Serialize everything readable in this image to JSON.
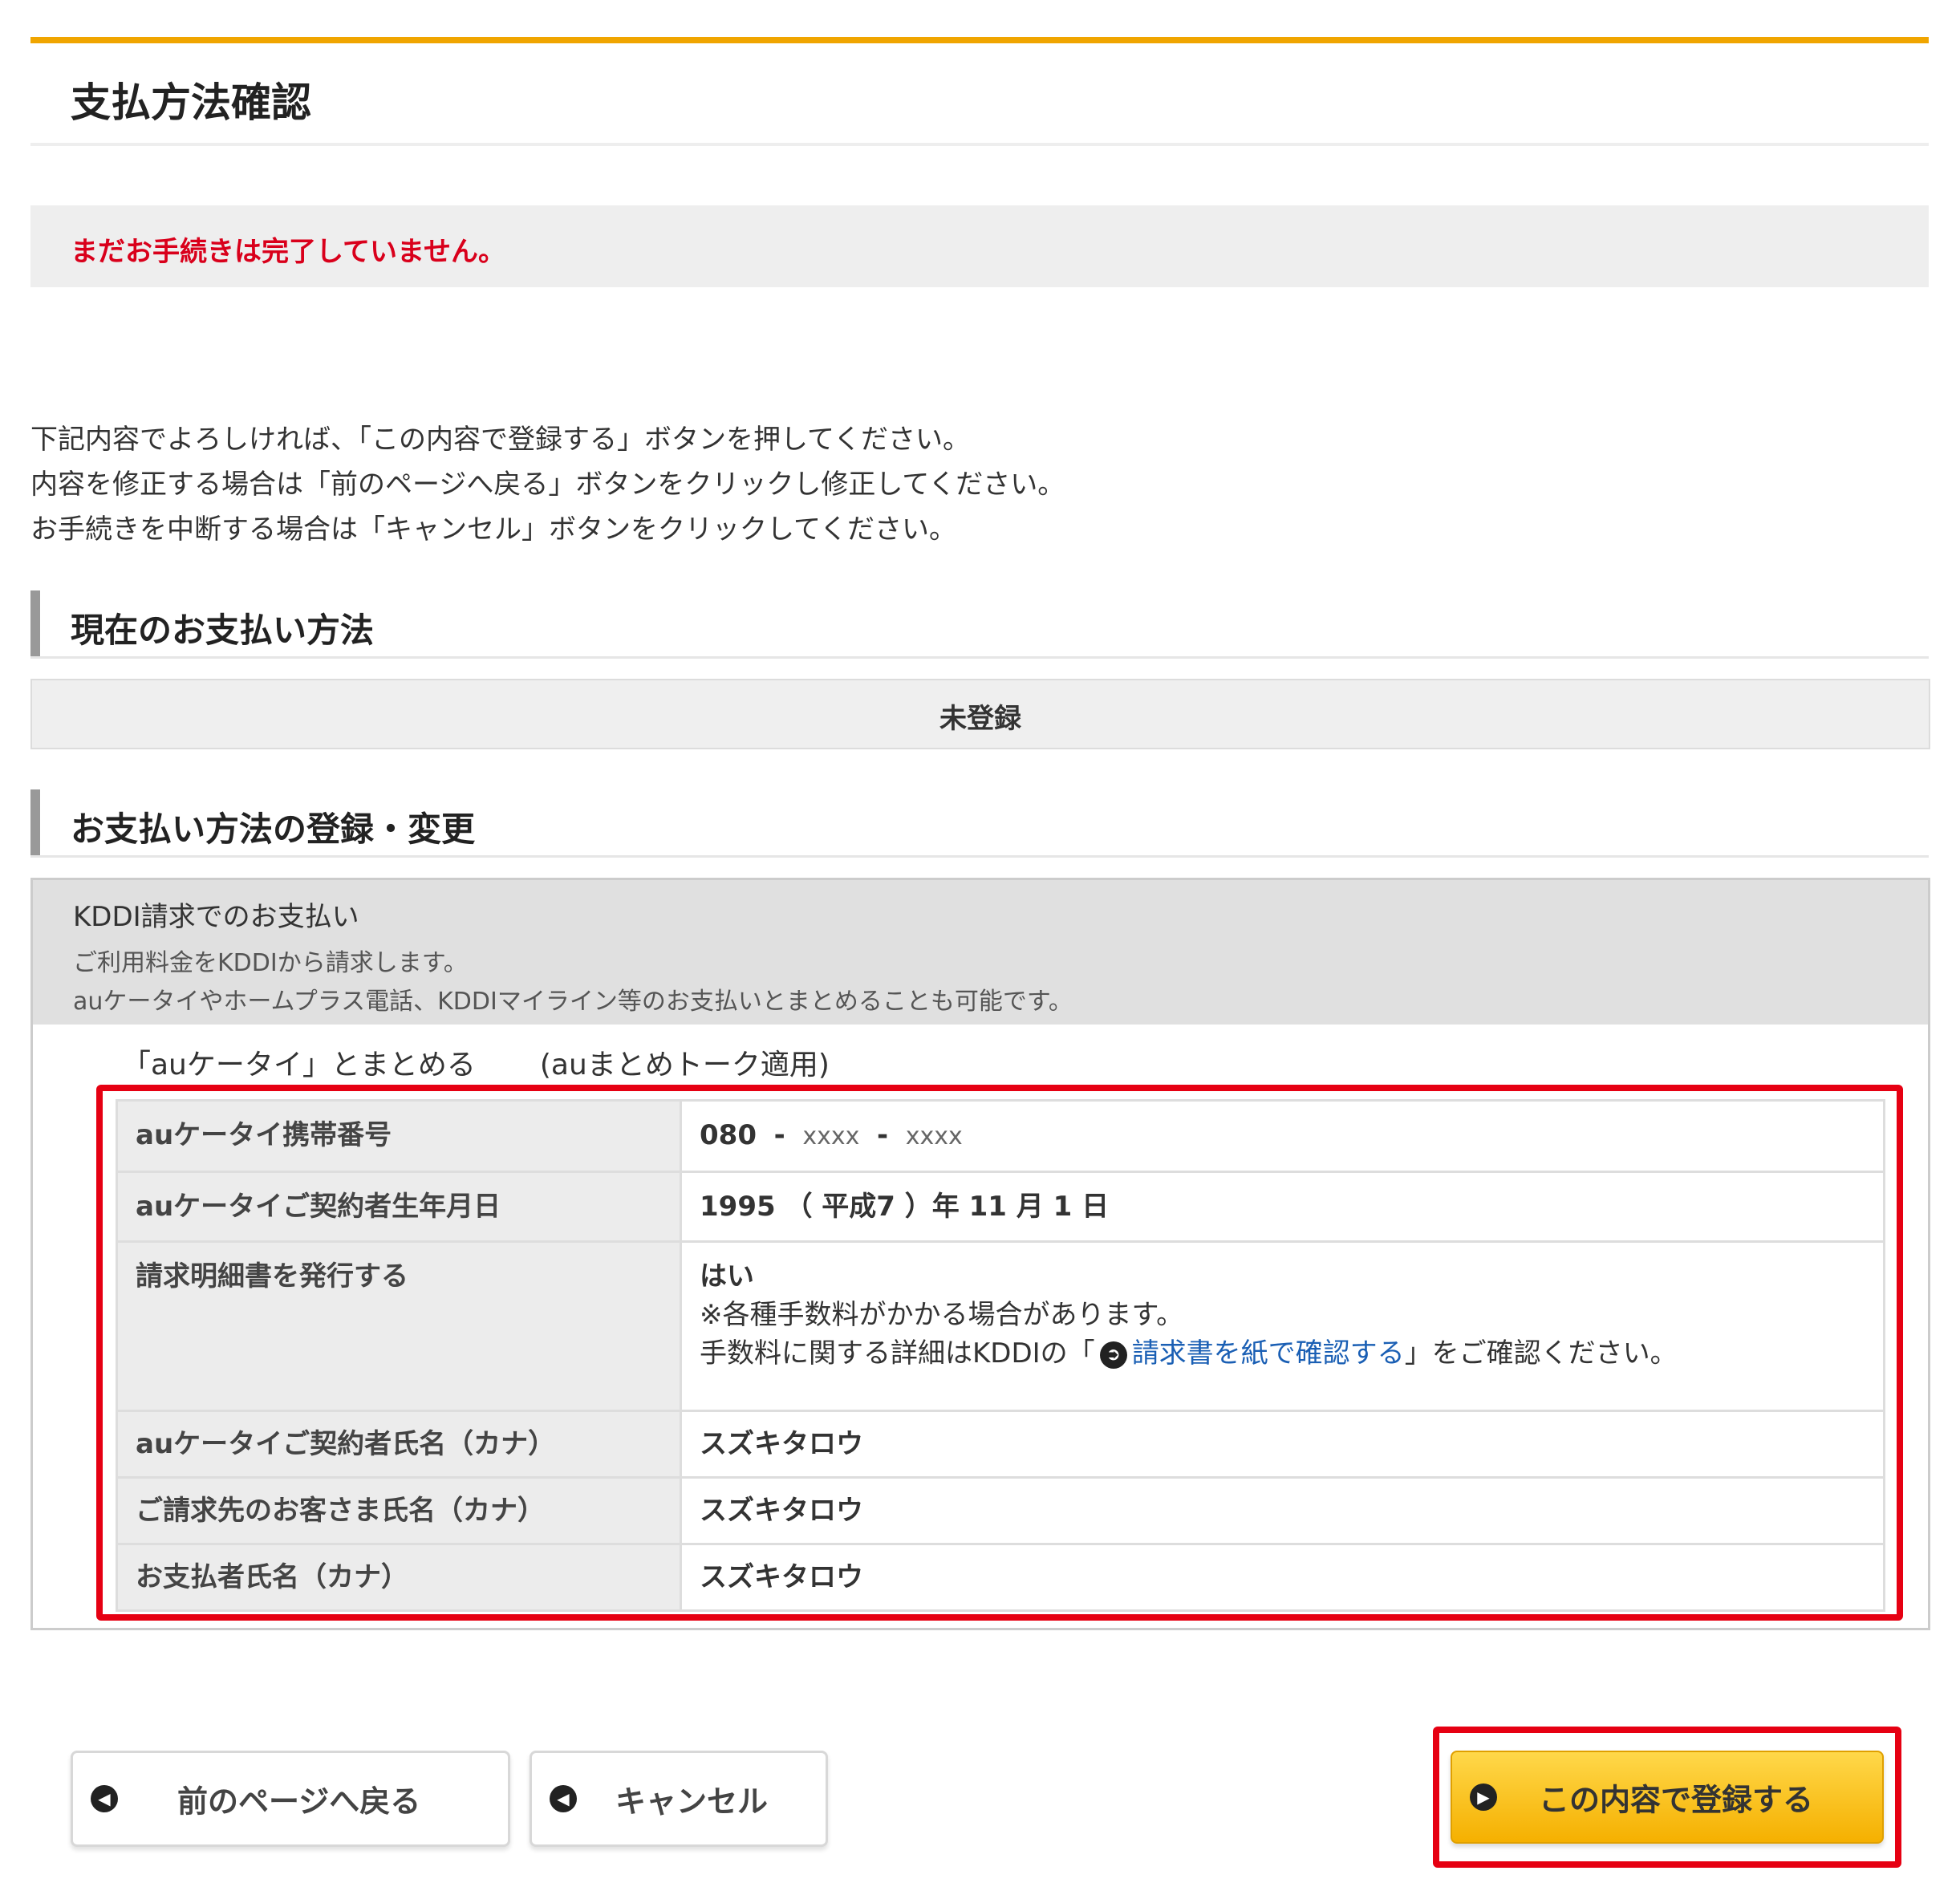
{
  "header": {
    "title": "支払方法確認",
    "notice": "まだお手続きは完了していません。"
  },
  "intro": [
    "下記内容でよろしければ、「この内容で登録する」ボタンを押してください。",
    "内容を修正する場合は「前のページへ戻る」ボタンをクリックし修正してください。",
    "お手続きを中断する場合は「キャンセル」ボタンをクリックしてください。"
  ],
  "current_section": {
    "heading": "現在のお支払い方法",
    "value": "未登録"
  },
  "register_section": {
    "heading": "お支払い方法の登録・変更",
    "kddi_title": "KDDI請求でのお支払い",
    "kddi_desc_1": "ご利用料金をKDDIから請求します。",
    "kddi_desc_2": "auケータイやホームプラス電話、KDDIマイライン等のお支払いとまとめることも可能です。",
    "combine_label": "「auケータイ」とまとめる",
    "combine_note": "(auまとめトーク適用)"
  },
  "table": {
    "phone_label": "auケータイ携帯番号",
    "phone_1": "080",
    "phone_sep": "-",
    "phone_2": "xxxx",
    "phone_3": "xxxx",
    "birth_label": "auケータイご契約者生年月日",
    "birth_value": "1995 （ 平成7 ）年 11 月 1 日",
    "invoice_label": "請求明細書を発行する",
    "invoice_value": "はい",
    "invoice_note": "※各種手数料がかかる場合があります。",
    "invoice_detail_pre": "手数料に関する詳細はKDDIの「",
    "invoice_link": "請求書を紙で確認する",
    "invoice_detail_post": "」をご確認ください。",
    "contract_name_label": "auケータイご契約者氏名（カナ）",
    "contract_name_value": "スズキタロウ",
    "billing_name_label": "ご請求先のお客さま氏名（カナ）",
    "billing_name_value": "スズキタロウ",
    "payer_name_label": "お支払者氏名（カナ）",
    "payer_name_value": "スズキタロウ"
  },
  "buttons": {
    "back": "前のページへ戻る",
    "cancel": "キャンセル",
    "submit": "この内容で登録する"
  },
  "icons": {
    "arrow": "arrow-left-circle-icon",
    "link": "external-link-circle-icon"
  },
  "colors": {
    "accent": "#f0a500",
    "alert": "#d9001b",
    "highlight_frame": "#e60012",
    "link": "#1a5fb4"
  }
}
